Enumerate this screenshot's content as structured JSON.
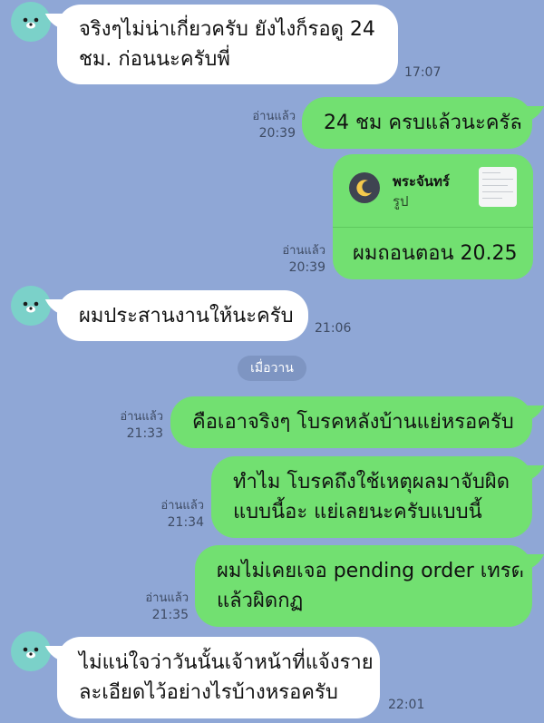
{
  "date_separator": "เมื่อวาน",
  "messages": [
    {
      "lines": [
        "จริงๆไม่น่าเกี่ยวครับ ยังไงก็รอดู 24",
        "ชม. ก่อนนะครับพี่"
      ],
      "time": "17:07"
    },
    {
      "lines": [
        "24 ชม ครบแล้วนะครัล"
      ],
      "read": "อ่านแล้ว",
      "time": "20:39"
    },
    {
      "read": "อ่านแล้ว",
      "time": "20:39",
      "card": {
        "title": "พระจันทร์",
        "subtitle": "รูป",
        "caption": "ผมถอนตอน 20.25"
      }
    },
    {
      "lines": [
        "ผมประสานงานให้นะครับ"
      ],
      "time": "21:06"
    },
    {
      "lines": [
        "คือเอาจริงๆ โบรคหลังบ้านแย่หรอครับ"
      ],
      "read": "อ่านแล้ว",
      "time": "21:33"
    },
    {
      "lines": [
        "ทำไม โบรคถึงใช้เหตุผลมาจับผิด",
        "แบบนี้อะ แย่เลยนะครับแบบนี้"
      ],
      "read": "อ่านแล้ว",
      "time": "21:34"
    },
    {
      "lines": [
        "ผมไม่เคยเจอ pending order เทรด",
        "แล้วผิดกฏ"
      ],
      "read": "อ่านแล้ว",
      "time": "21:35"
    },
    {
      "lines": [
        "ไม่แน่ใจว่าวันนั้นเจ้าหน้าที่แจ้งราย",
        "ละเอียดไว้อย่างไรบ้างหรอครับ"
      ],
      "time": "22:01"
    }
  ],
  "colors": {
    "background": "#8fa7d6",
    "outgoing": "#72e071",
    "incoming": "#ffffff",
    "avatar": "#7bd1c9"
  },
  "icons": {
    "avatar": "bear-avatar-icon",
    "card": "moon-icon"
  }
}
